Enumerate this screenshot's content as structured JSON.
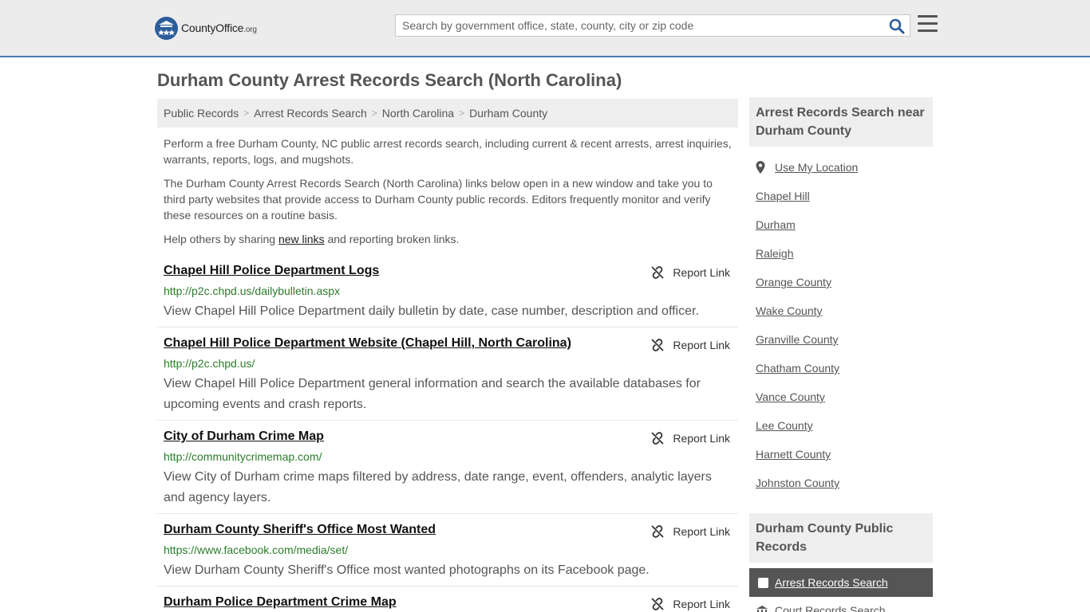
{
  "header": {
    "logo_text": "CountyOffice",
    "logo_suffix": ".org",
    "search_placeholder": "Search by government office, state, county, city or zip code"
  },
  "page": {
    "title": "Durham County Arrest Records Search (North Carolina)"
  },
  "breadcrumb": [
    "Public Records",
    "Arrest Records Search",
    "North Carolina",
    "Durham County"
  ],
  "intro": {
    "p1": "Perform a free Durham County, NC public arrest records search, including current & recent arrests, arrest inquiries, warrants, reports, logs, and mugshots.",
    "p2": "The Durham County Arrest Records Search (North Carolina) links below open in a new window and take you to third party websites that provide access to Durham County public records. Editors frequently monitor and verify these resources on a routine basis.",
    "p3_before": "Help others by sharing ",
    "p3_link": "new links",
    "p3_after": " and reporting broken links."
  },
  "report_label": "Report Link",
  "results": [
    {
      "title": "Chapel Hill Police Department Logs",
      "url": "http://p2c.chpd.us/dailybulletin.aspx",
      "desc": "View Chapel Hill Police Department daily bulletin by date, case number, description and officer."
    },
    {
      "title": "Chapel Hill Police Department Website (Chapel Hill, North Carolina)",
      "url": "http://p2c.chpd.us/",
      "desc": "View Chapel Hill Police Department general information and search the available databases for upcoming events and crash reports."
    },
    {
      "title": "City of Durham Crime Map",
      "url": "http://communitycrimemap.com/",
      "desc": "View City of Durham crime maps filtered by address, date range, event, offenders, analytic layers and agency layers."
    },
    {
      "title": "Durham County Sheriff's Office Most Wanted",
      "url": "https://www.facebook.com/media/set/",
      "desc": "View Durham County Sheriff's Office most wanted photographs on its Facebook page."
    },
    {
      "title": "Durham Police Department Crime Map",
      "url": "",
      "desc": ""
    }
  ],
  "sidebar": {
    "nearby_heading": "Arrest Records Search near Durham County",
    "use_location": "Use My Location",
    "nearby": [
      "Chapel Hill",
      "Durham",
      "Raleigh",
      "Orange County",
      "Wake County",
      "Granville County",
      "Chatham County",
      "Vance County",
      "Lee County",
      "Harnett County",
      "Johnston County"
    ],
    "public_heading": "Durham County Public Records",
    "active_item": "Arrest Records Search",
    "next_item": "Court Records Search"
  }
}
